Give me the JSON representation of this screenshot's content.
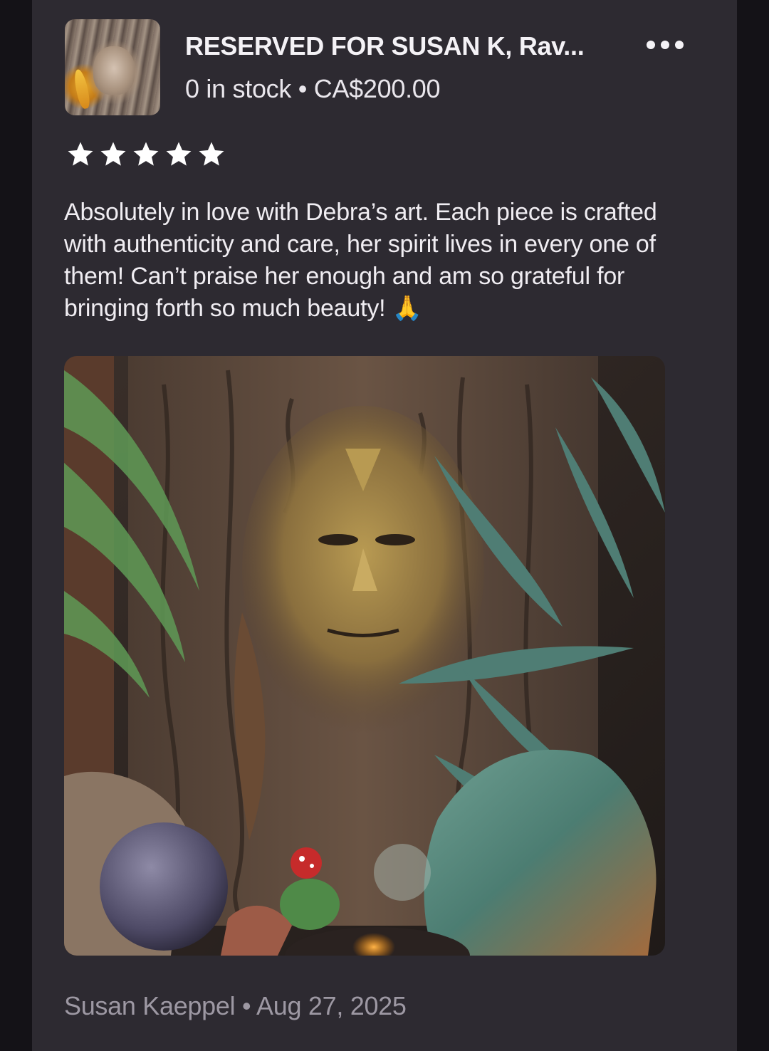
{
  "listing": {
    "title": "RESERVED FOR SUSAN K, Rav...",
    "stock_price": "0 in stock • CA$200.00",
    "thumbnail_icon": "listing-thumbnail-tree-spirit-face"
  },
  "menu": {
    "icon": "more-options-icon"
  },
  "review": {
    "rating": 5,
    "max_rating": 5,
    "text": "Absolutely in love with Debra’s art. Each piece is crafted with authenticity and care, her spirit lives in every one of them! Can’t praise her enough and am so grateful for bringing forth so much beauty! 🙏",
    "photo_icon": "review-photo-bark-face-sculpture",
    "footer": "Susan Kaeppel • Aug 27, 2025"
  },
  "colors": {
    "card_background": "#2d2a31",
    "page_background": "#141217",
    "text_primary": "#f4f2f6",
    "text_muted": "#9d98a3",
    "star": "#ffffff"
  }
}
